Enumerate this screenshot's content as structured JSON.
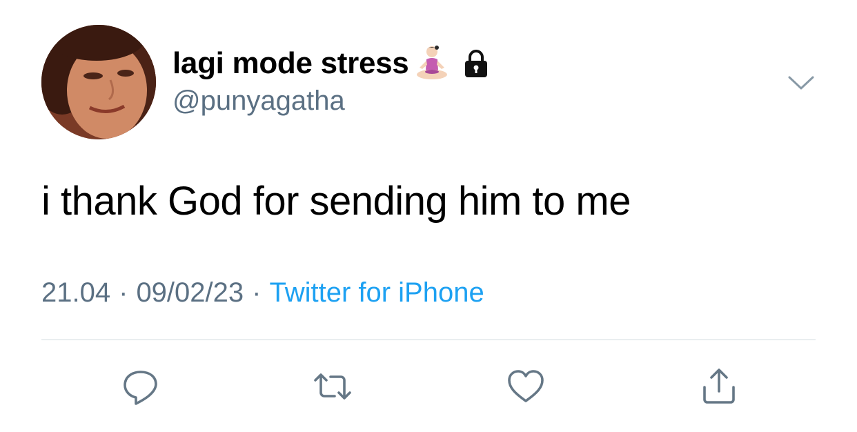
{
  "user": {
    "display_name": "lagi mode stress",
    "handle": "@punyagatha",
    "name_emoji": "person-in-lotus-position",
    "protected_icon": "lock-icon",
    "avatar_icon": "profile-photo"
  },
  "tweet": {
    "text": "i thank God for sending him to me",
    "time": "21.04",
    "separator": "·",
    "date": "09/02/23",
    "source": "Twitter for iPhone"
  },
  "actions": {
    "reply_icon": "reply-icon",
    "retweet_icon": "retweet-icon",
    "like_icon": "like-icon",
    "share_icon": "share-icon",
    "more_icon": "chevron-down-icon"
  },
  "colors": {
    "text": "#000000",
    "secondary": "#5b7083",
    "link": "#1da1f2",
    "divider": "#cfd9de"
  }
}
